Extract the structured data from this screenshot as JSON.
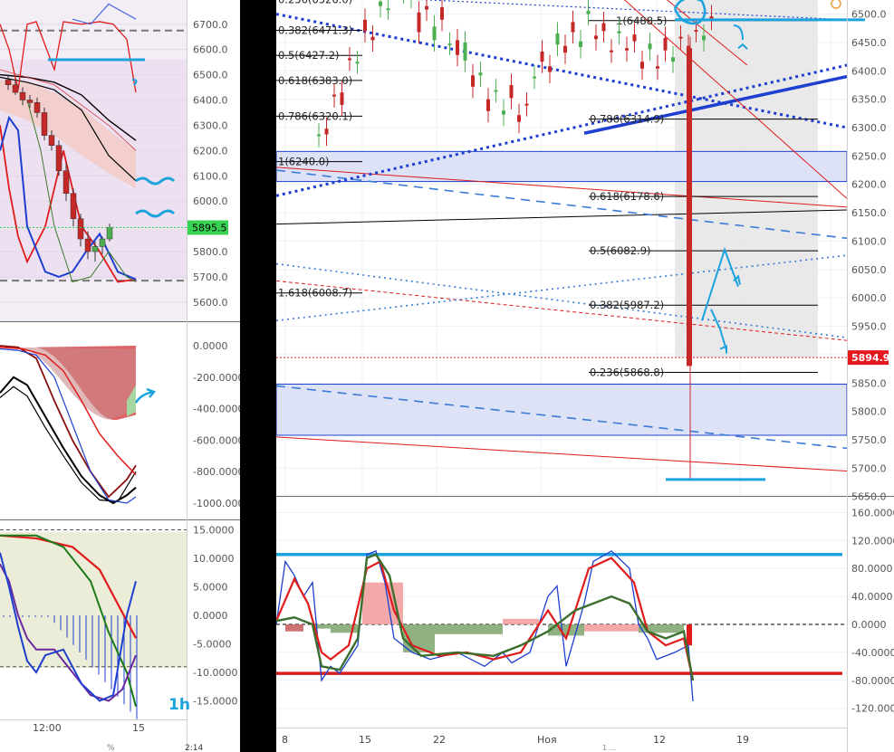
{
  "left_panel": {
    "timeframe_label": "1h",
    "price_axis_ticks": [
      "6700.0",
      "6600.0",
      "6500.0",
      "6400.0",
      "6300.0",
      "6200.0",
      "6100.0",
      "6000.0",
      "5900.0",
      "5800.0",
      "5700.0",
      "5600.0"
    ],
    "current_price_badge": "5895.5",
    "osc1_axis_ticks": [
      "0.0000",
      "-200.0000",
      "-400.0000",
      "-600.0000",
      "-800.0000",
      "-1000.0000"
    ],
    "osc2_axis_ticks": [
      "15.0000",
      "10.0000",
      "5.0000",
      "0.0000",
      "-5.0000",
      "-10.0000",
      "-15.0000"
    ],
    "time_ticks": [
      "12:00",
      "15"
    ],
    "footer_fragment": "2:14",
    "footer_fragment_2": "%"
  },
  "right_panel": {
    "current_price_badge": "5894.9",
    "footer_fragment": "1 ..."
  },
  "colors": {
    "up_candle": "#4caf50",
    "down_candle": "#c62828",
    "fib_line": "#000000",
    "channel_blue": "#1e3fcf",
    "annotation_cyan": "#1ca3dd",
    "panel_bg": "#ffffff",
    "price_badge": "#e5191e",
    "left_badge": "#39d353"
  },
  "chart_data": [
    {
      "type": "line",
      "name": "left-price-chart-1h",
      "x": [
        "",
        "12:00",
        "",
        "15"
      ],
      "y_ticks": [
        6700,
        6600,
        6500,
        6400,
        6300,
        6200,
        6100,
        6000,
        5900,
        5800,
        5700,
        5600
      ],
      "ylim": [
        5560,
        6760
      ],
      "candles": [
        {
          "o": 6480,
          "h": 6500,
          "l": 6440,
          "c": 6460
        },
        {
          "o": 6460,
          "h": 6480,
          "l": 6420,
          "c": 6430
        },
        {
          "o": 6430,
          "h": 6450,
          "l": 6380,
          "c": 6400
        },
        {
          "o": 6400,
          "h": 6420,
          "l": 6370,
          "c": 6390
        },
        {
          "o": 6390,
          "h": 6410,
          "l": 6330,
          "c": 6350
        },
        {
          "o": 6350,
          "h": 6370,
          "l": 6240,
          "c": 6260
        },
        {
          "o": 6260,
          "h": 6280,
          "l": 6200,
          "c": 6220
        },
        {
          "o": 6220,
          "h": 6240,
          "l": 6100,
          "c": 6120
        },
        {
          "o": 6120,
          "h": 6150,
          "l": 6000,
          "c": 6030
        },
        {
          "o": 6030,
          "h": 6050,
          "l": 5900,
          "c": 5930
        },
        {
          "o": 5930,
          "h": 5950,
          "l": 5820,
          "c": 5850
        },
        {
          "o": 5850,
          "h": 5880,
          "l": 5770,
          "c": 5800
        },
        {
          "o": 5800,
          "h": 5840,
          "l": 5760,
          "c": 5820
        },
        {
          "o": 5820,
          "h": 5860,
          "l": 5790,
          "c": 5850
        },
        {
          "o": 5850,
          "h": 5910,
          "l": 5840,
          "c": 5895
        }
      ],
      "horizontal_levels": [
        6675,
        5685
      ]
    },
    {
      "type": "line",
      "name": "right-price-chart",
      "x": [
        "8",
        "15",
        "22",
        "Ноя",
        "12",
        "19"
      ],
      "y_ticks": [
        6500,
        6450,
        6400,
        6350,
        6300,
        6250,
        6200,
        6150,
        6100,
        6050,
        6000,
        5950,
        5900,
        5850,
        5800,
        5750,
        5700,
        5650
      ],
      "ylim": [
        5640,
        6520
      ],
      "fibonacci_labels": [
        {
          "label": "0.236(6526.0)",
          "value": 6526.0
        },
        {
          "label": "0.382(6471.3)",
          "value": 6471.3
        },
        {
          "label": "0.5(6427.2)",
          "value": 6427.2
        },
        {
          "label": "0.618(6383.0)",
          "value": 6383.0
        },
        {
          "label": "0.786(6320.1)",
          "value": 6320.1
        },
        {
          "label": "1(6240.0)",
          "value": 6240.0
        },
        {
          "label": "1.618(6008.7)",
          "value": 6008.7
        },
        {
          "label": "1(6488.5)",
          "value": 6488.5
        },
        {
          "label": "0.786(6314.9)",
          "value": 6314.9
        },
        {
          "label": "0.618(6178.6)",
          "value": 6178.6
        },
        {
          "label": "0.5(6082.9)",
          "value": 6082.9
        },
        {
          "label": "0.382(5987.2)",
          "value": 5987.2
        },
        {
          "label": "0.236(5868.8)",
          "value": 5868.8
        }
      ],
      "last_price": 5894.9,
      "low": 5680
    },
    {
      "type": "line",
      "name": "right-oscillator",
      "y_ticks": [
        160,
        120,
        80,
        40,
        0,
        -40,
        -80,
        -120
      ],
      "ylim": [
        -135,
        165
      ],
      "levels": [
        100,
        -70,
        0
      ]
    }
  ]
}
